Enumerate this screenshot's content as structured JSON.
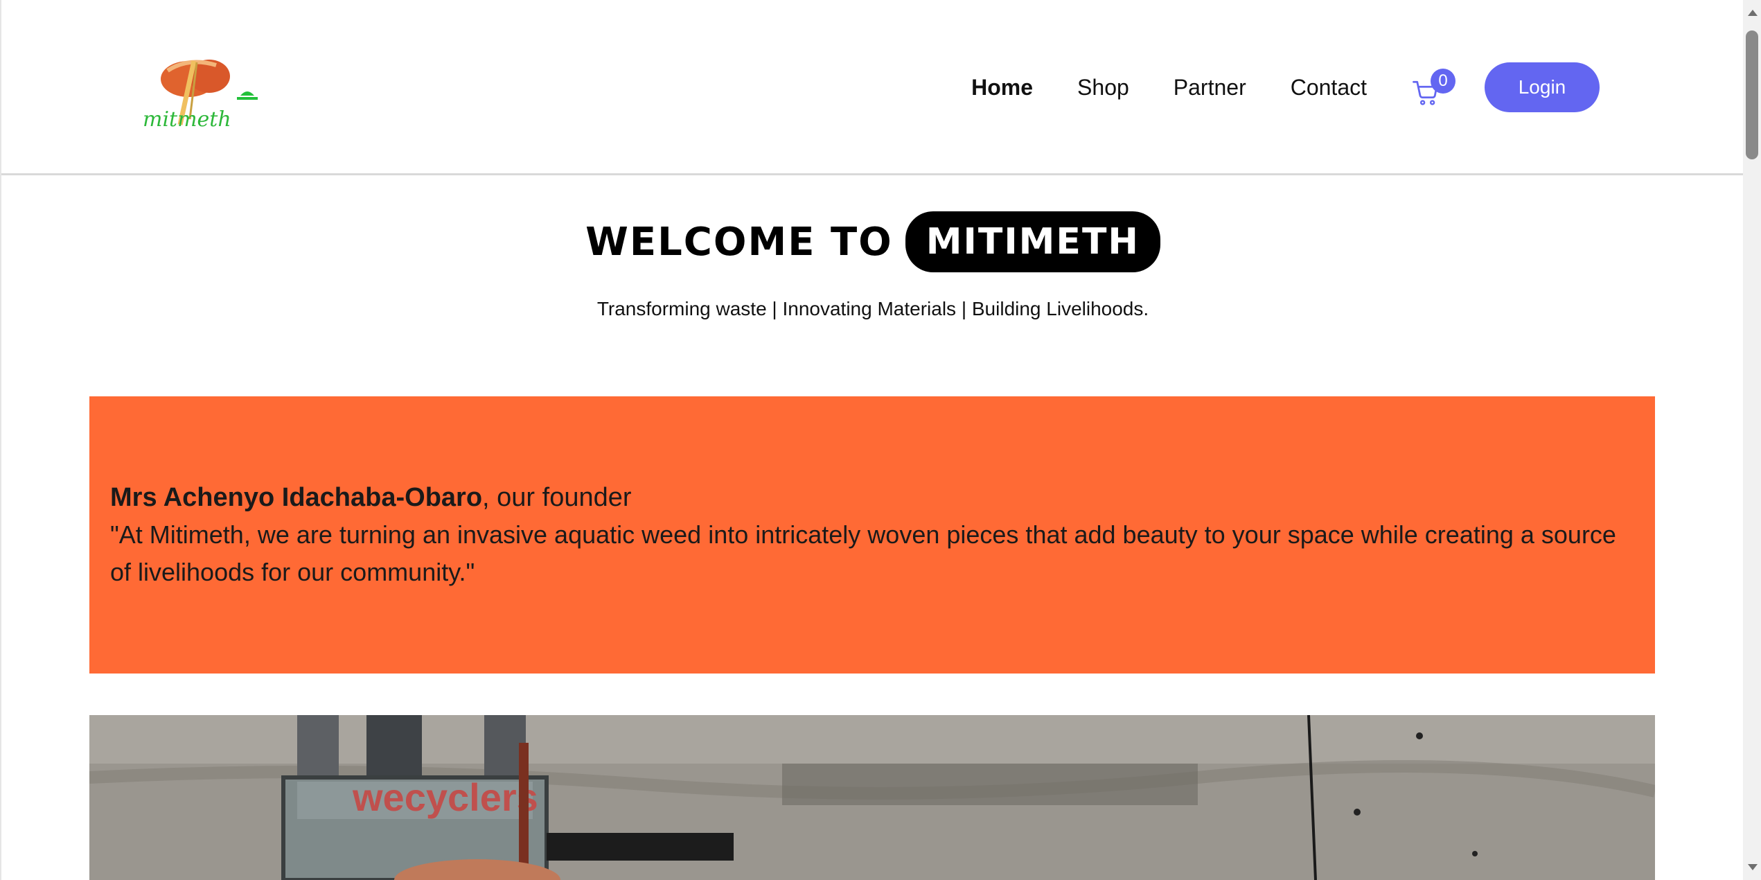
{
  "header": {
    "logo_text": "mitmeth",
    "nav": [
      {
        "label": "Home"
      },
      {
        "label": "Shop"
      },
      {
        "label": "Partner"
      },
      {
        "label": "Contact"
      }
    ],
    "cart_count": "0",
    "login_label": "Login",
    "accent_color": "#6366f1"
  },
  "hero": {
    "welcome": "WELCOME TO",
    "brand": "MITIMETH",
    "tagline": "Transforming waste | Innovating Materials | Building Livelihoods."
  },
  "quote": {
    "founder_name": "Mrs Achenyo Idachaba-Obaro",
    "founder_role": ", our founder",
    "text": "\"At Mitimeth, we are turning an invasive aquatic weed into intricately woven pieces that add beauty to your space while creating a source of livelihoods for our community.\"",
    "background_color": "#ff6a35"
  },
  "photo": {
    "sign_text": "wecyclers"
  }
}
